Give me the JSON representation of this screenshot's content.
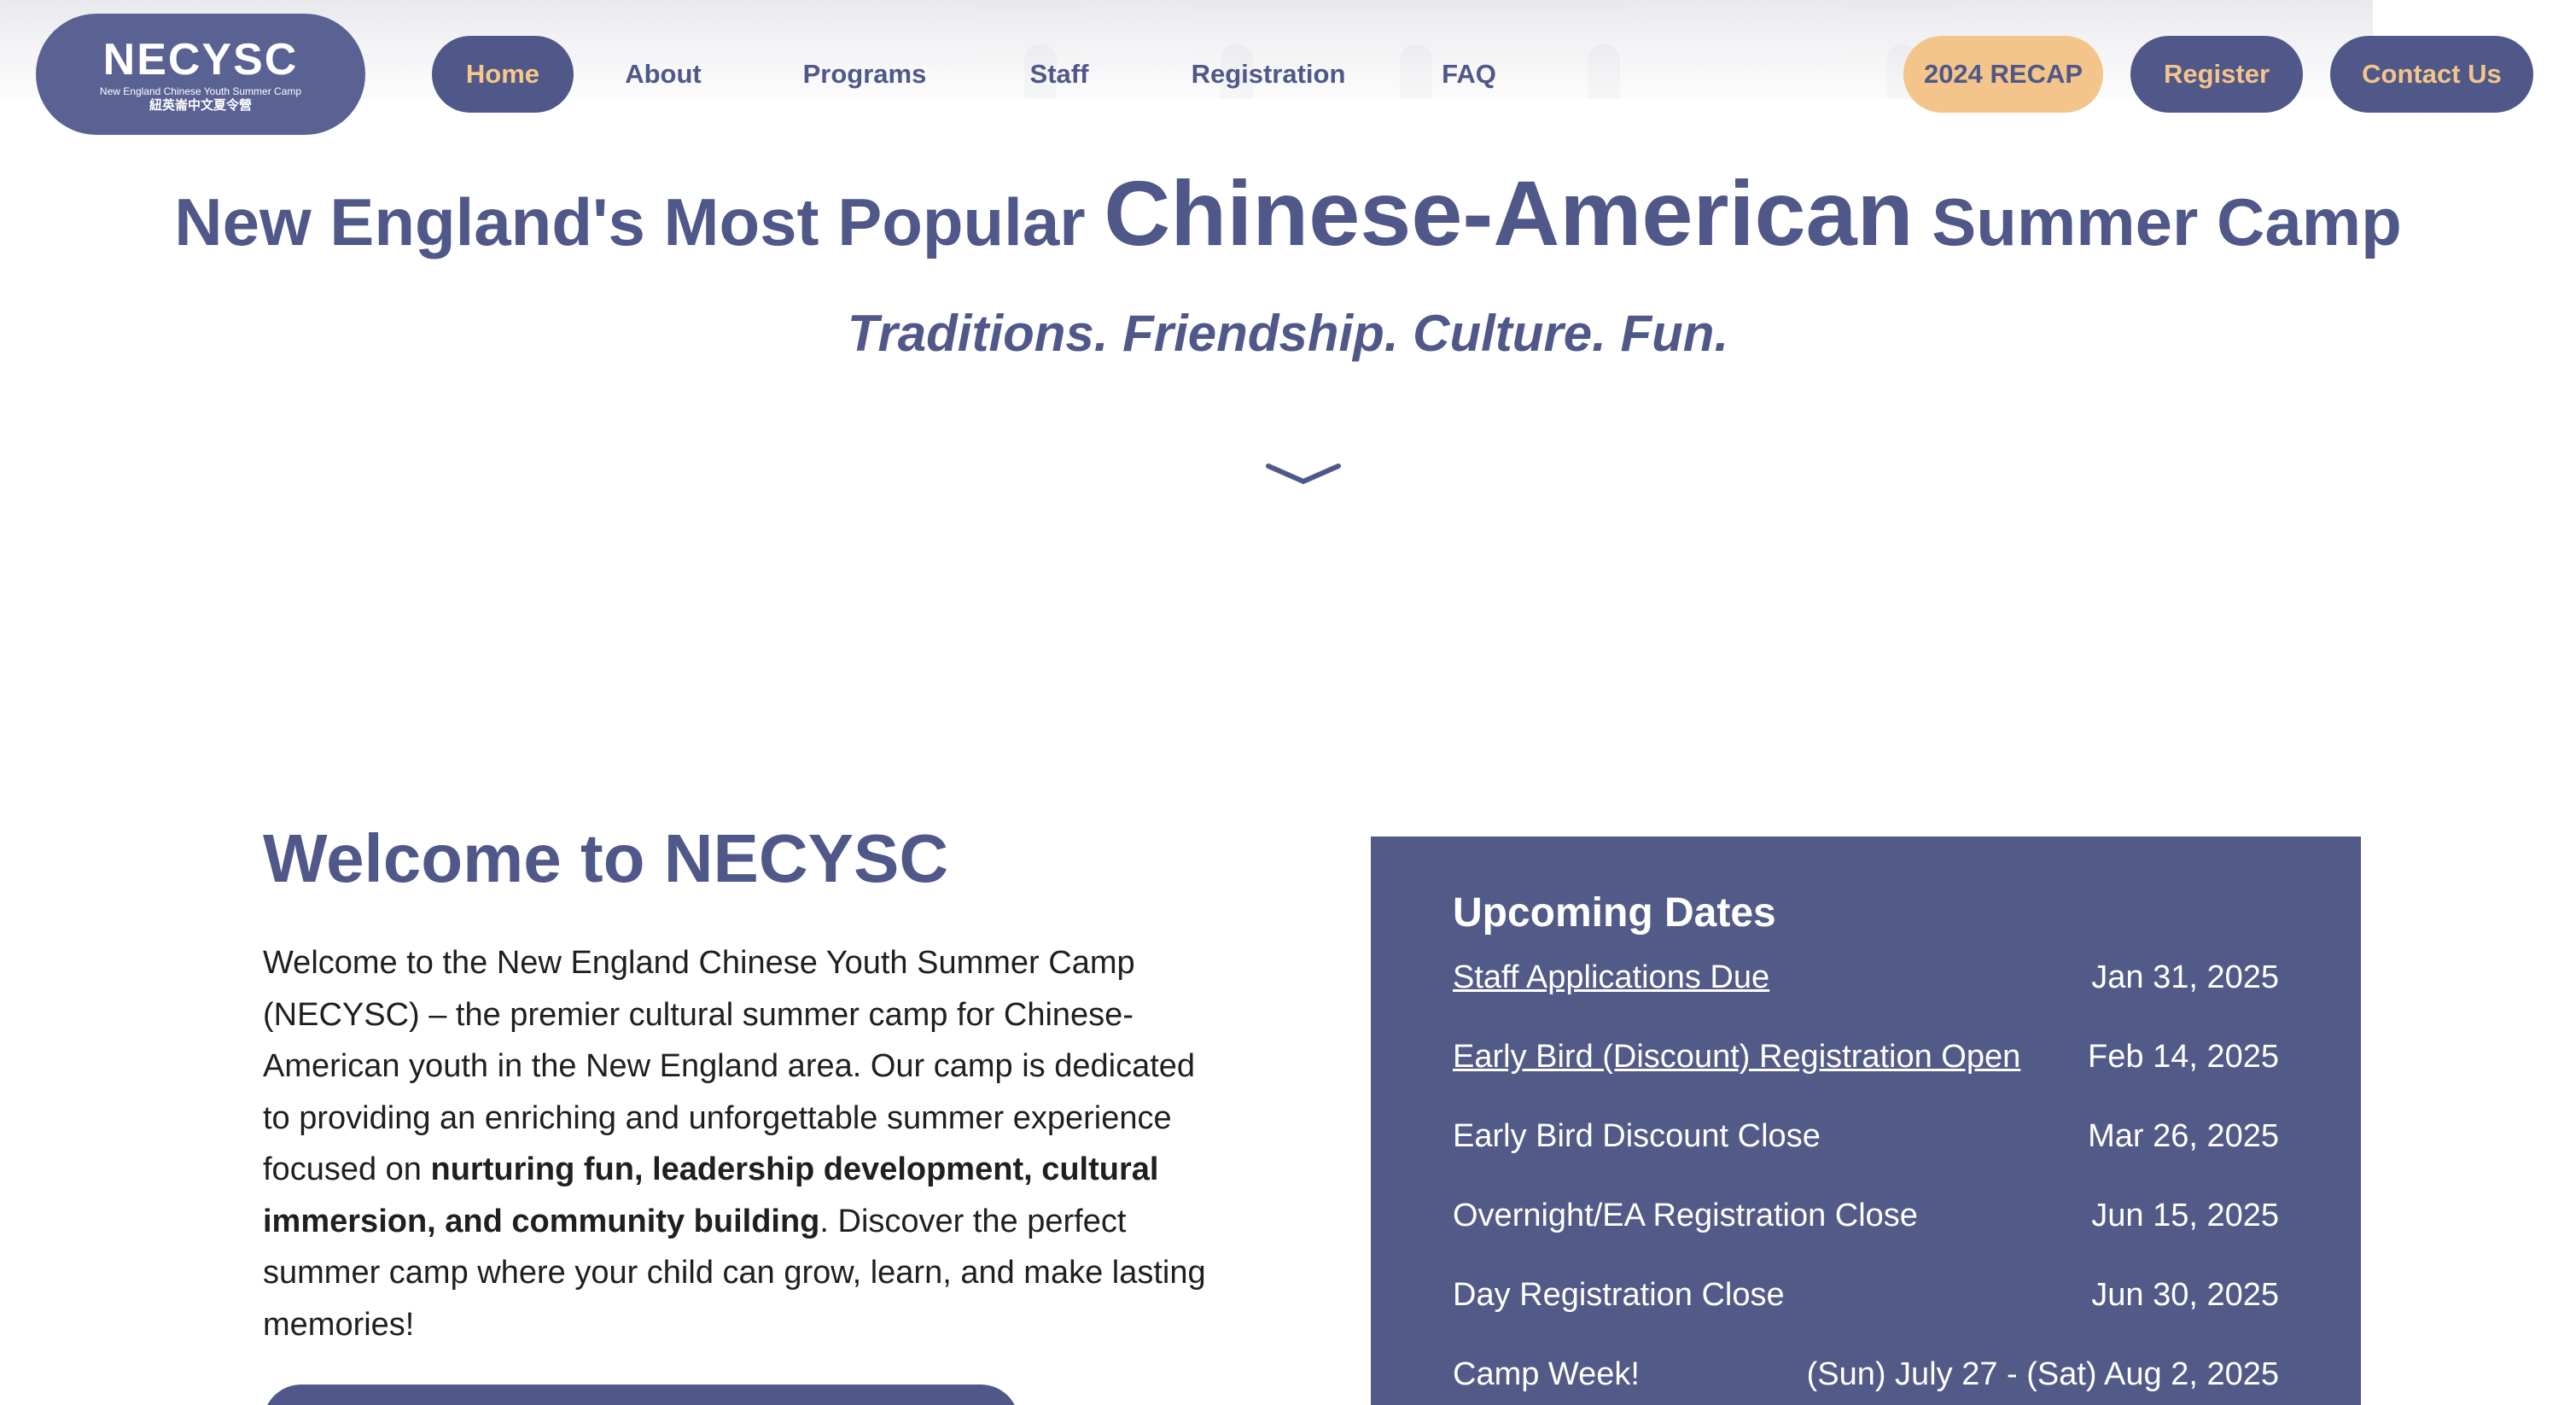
{
  "logo": {
    "main": "NECYSC",
    "sub": "New England Chinese Youth Summer Camp",
    "cn": "紐英崙中文夏令營"
  },
  "nav": {
    "home": "Home",
    "about": "About",
    "programs": "Programs",
    "staff": "Staff",
    "registration": "Registration",
    "faq": "FAQ",
    "recap": "2024 RECAP",
    "register": "Register",
    "contact": "Contact Us"
  },
  "hero": {
    "headline_pre": "New England's Most Popular ",
    "headline_strong": "Chinese-American",
    "headline_post": " Summer Camp",
    "tagline": "Traditions. Friendship. Culture. Fun."
  },
  "welcome": {
    "title": "Welcome to NECYSC",
    "body_part1": "Welcome to the New England Chinese Youth Summer Camp (NECYSC) – the premier cultural summer camp for Chinese-American youth in the New England area. Our camp is dedicated to providing an enriching and unforgettable summer experience focused on ",
    "body_bold": "nurturing fun, leadership development, cultural immersion, and community building",
    "body_part2": ". Discover the perfect summer camp where your child can grow, learn, and make lasting memories!"
  },
  "dates": {
    "title": "Upcoming Dates",
    "rows": [
      {
        "label": "Staff Applications Due",
        "date": "Jan 31, 2025"
      },
      {
        "label": "Early Bird (Discount) Registration Open",
        "date": "Feb 14, 2025"
      },
      {
        "label": "Early Bird Discount Close",
        "date": "Mar 26, 2025"
      },
      {
        "label": "Overnight/EA Registration Close",
        "date": "Jun 15, 2025"
      },
      {
        "label": "Day Registration Close",
        "date": "Jun 30, 2025"
      },
      {
        "label": "Camp Week!",
        "date": "(Sun) July 27 - (Sat) Aug 2, 2025"
      }
    ]
  },
  "colors": {
    "brand": "#4f5888",
    "accent": "#f3c58a",
    "panel": "#525a88"
  },
  "icons": {
    "scroll_down": "chevron-down-icon"
  }
}
